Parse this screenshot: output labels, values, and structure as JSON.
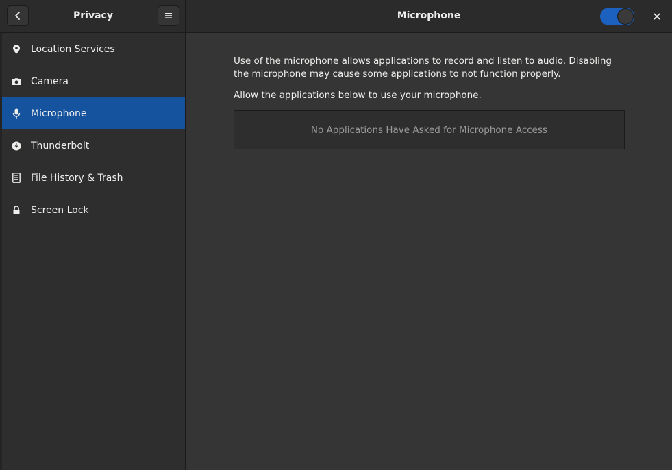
{
  "header": {
    "left_title": "Privacy",
    "right_title": "Microphone",
    "back_icon": "chevron-left-icon",
    "menu_icon": "hamburger-menu-icon",
    "close_icon": "close-icon",
    "toggle_on": true
  },
  "sidebar": {
    "items": [
      {
        "label": "Location Services",
        "icon": "location-pin-icon",
        "selected": false
      },
      {
        "label": "Camera",
        "icon": "camera-icon",
        "selected": false
      },
      {
        "label": "Microphone",
        "icon": "microphone-icon",
        "selected": true
      },
      {
        "label": "Thunderbolt",
        "icon": "thunderbolt-icon",
        "selected": false
      },
      {
        "label": "File History & Trash",
        "icon": "file-history-icon",
        "selected": false
      },
      {
        "label": "Screen Lock",
        "icon": "lock-icon",
        "selected": false
      }
    ]
  },
  "main": {
    "description": "Use of the microphone allows applications to record and listen to audio. Disabling the microphone may cause some applications to not function properly.",
    "allow_text": "Allow the applications below to use your microphone.",
    "empty_message": "No Applications Have Asked for Microphone Access"
  },
  "colors": {
    "accent": "#15539e",
    "toggle_on": "#1c61c0",
    "background": "#353535",
    "sidebar": "#2e2e2e",
    "headerbar": "#2b2b2b"
  }
}
